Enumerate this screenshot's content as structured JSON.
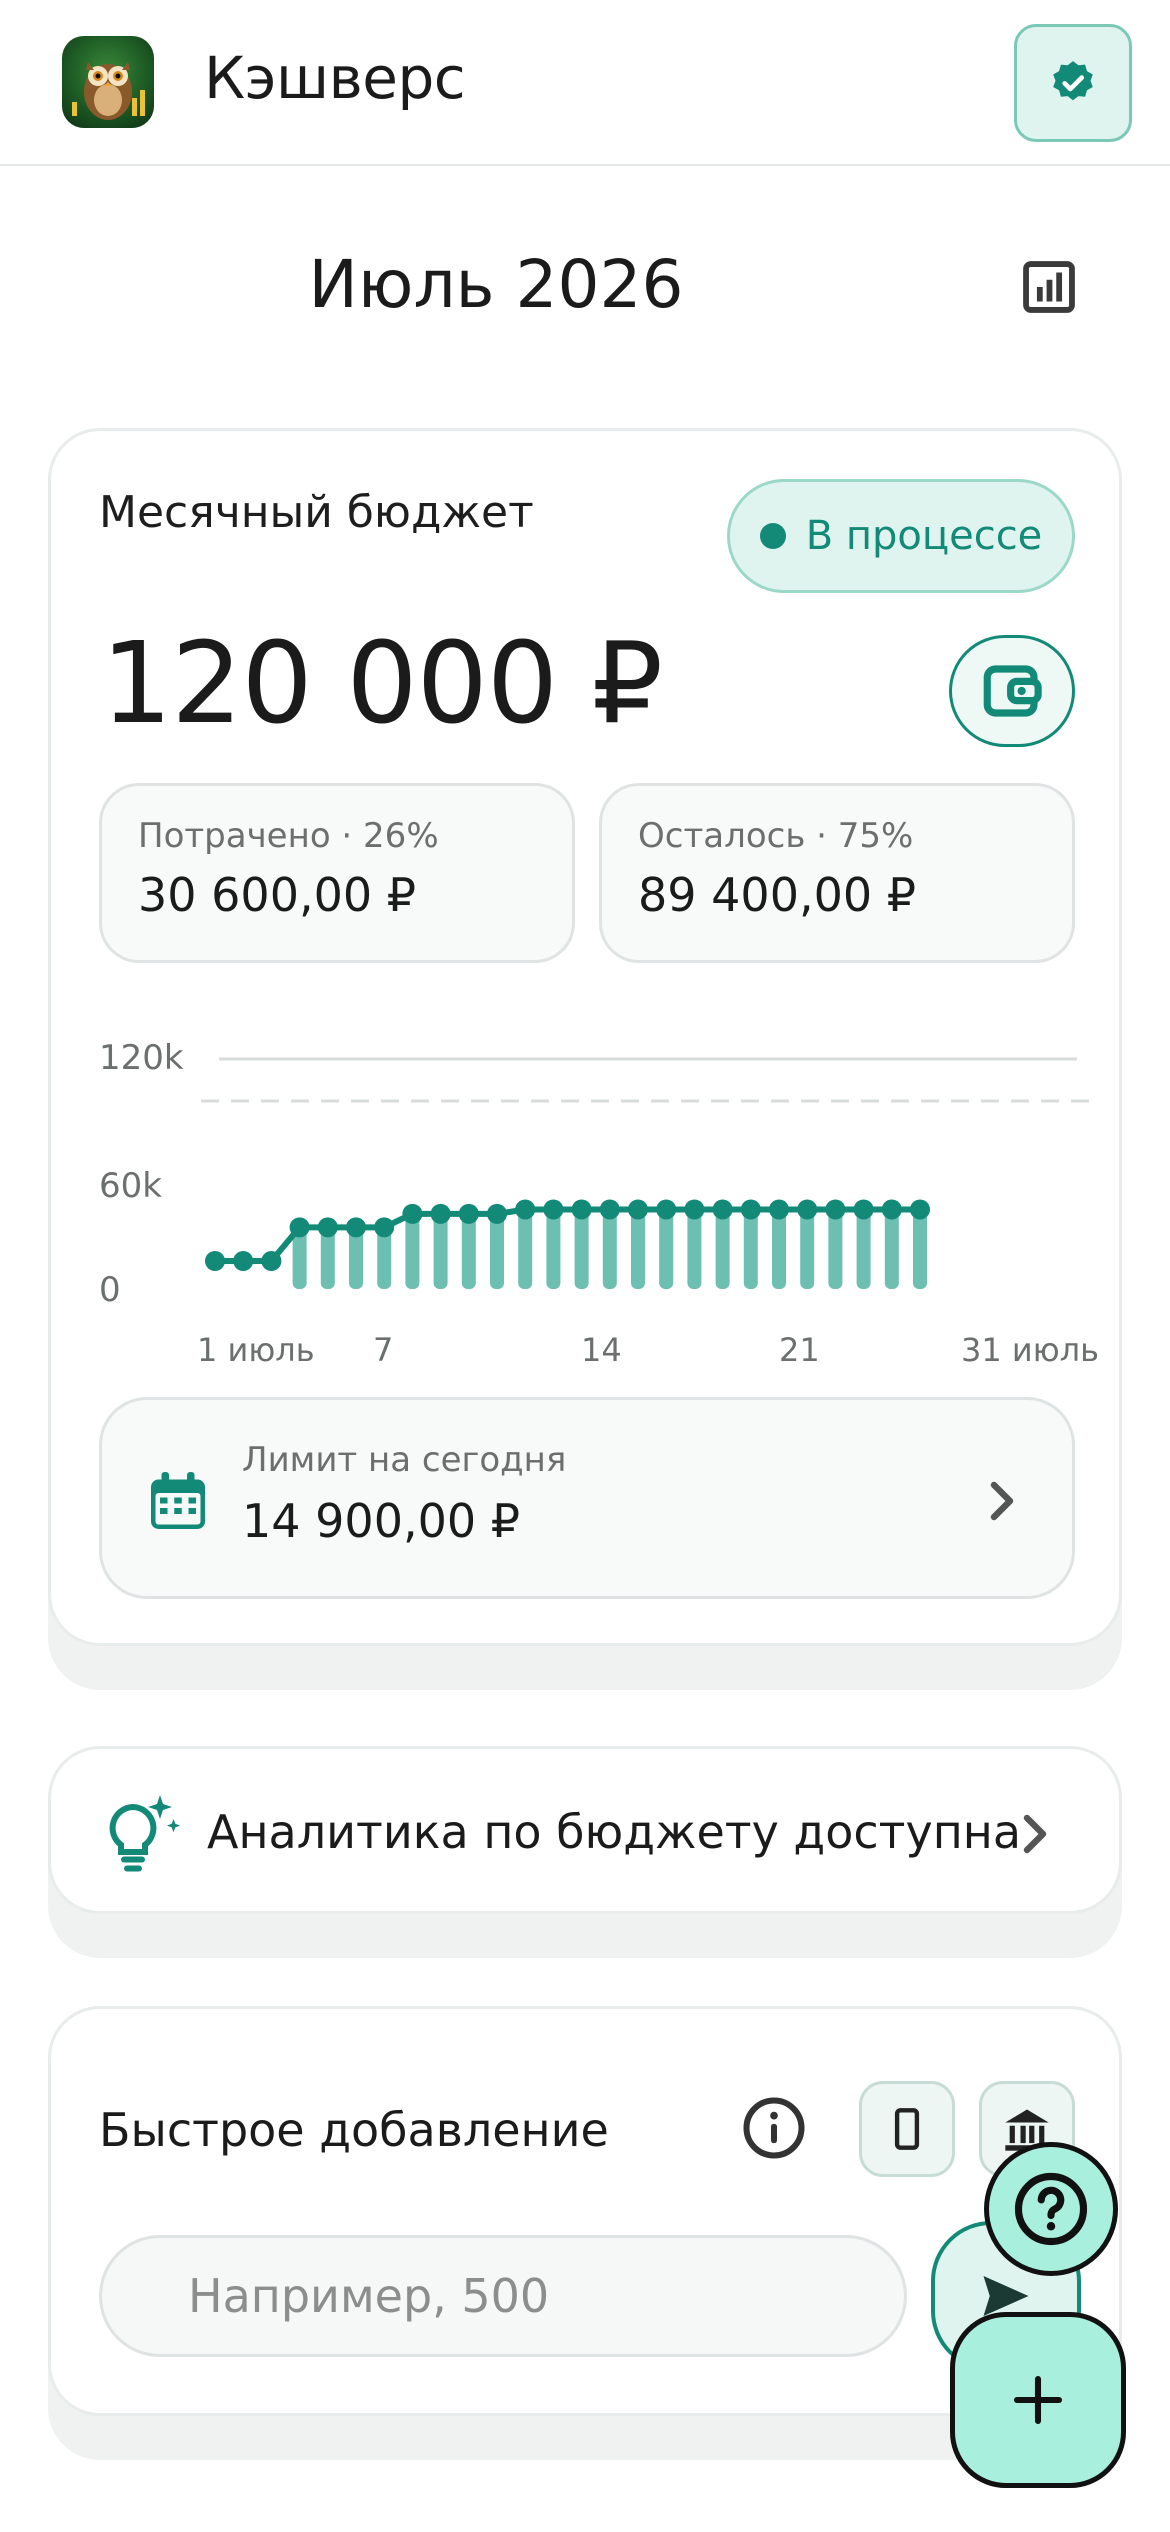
{
  "header": {
    "app_title": "Кэшверс",
    "app_icon": "owl-logo-icon",
    "verify_icon": "verified-badge-icon"
  },
  "month": {
    "title": "Июль 2026",
    "stats_icon": "bar-chart-icon"
  },
  "budget": {
    "label": "Месячный бюджет",
    "status": "В процессе",
    "amount": "120 000 ₽",
    "wallet_icon": "wallet-icon",
    "spent_label": "Потрачено · 26%",
    "spent_value": "30 600,00 ₽",
    "left_label": "Осталось · 75%",
    "left_value": "89 400,00 ₽",
    "limit_label": "Лимит на сегодня",
    "limit_value": "14 900,00 ₽",
    "limit_icon": "calendar-icon"
  },
  "chart_data": {
    "type": "line",
    "y_ticks": [
      "120k",
      "60k",
      "0"
    ],
    "x_ticks": [
      "1 июль",
      "7",
      "14",
      "21",
      "31 июль"
    ],
    "ylim": [
      0,
      120000
    ],
    "budget_line": 120000,
    "x": [
      1,
      2,
      3,
      4,
      5,
      6,
      7,
      8,
      9,
      10,
      11,
      12,
      13,
      14,
      15,
      16,
      17,
      18,
      19,
      20,
      21,
      22,
      23,
      24,
      25,
      26
    ],
    "values": [
      0,
      0,
      0,
      20000,
      20000,
      20000,
      20000,
      28000,
      28000,
      28000,
      28000,
      30600,
      30600,
      30600,
      30600,
      30600,
      30600,
      30600,
      30600,
      30600,
      30600,
      30600,
      30600,
      30600,
      30600,
      30600
    ],
    "colors": {
      "line": "#138a78",
      "bar": "#6cbfb1",
      "grid": "#d8dcdb"
    }
  },
  "analytics": {
    "text": "Аналитика по бюджету доступна",
    "icon": "lightbulb-sparkle-icon"
  },
  "quick_add": {
    "title": "Быстрое добавление",
    "placeholder": "Например, 500",
    "info_icon": "info-icon",
    "phone_icon": "phone-icon",
    "bank_icon": "bank-icon",
    "send_icon": "send-icon"
  },
  "fab": {
    "help_icon": "help-icon",
    "add_icon": "plus-icon"
  },
  "colors": {
    "accent": "#138a78",
    "accent_light": "#dff4ee",
    "fab": "#a8efdd"
  }
}
